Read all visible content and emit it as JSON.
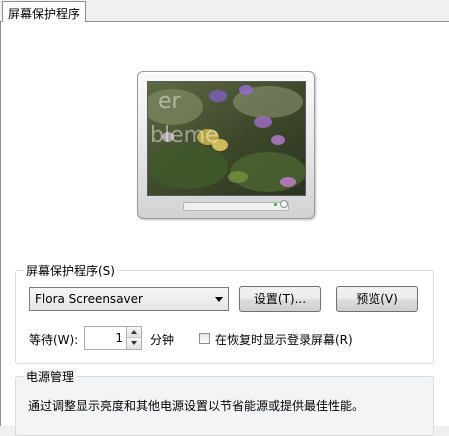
{
  "tab": {
    "label": "屏幕保护程序"
  },
  "screensaver_group": {
    "title": "屏幕保护程序(S)",
    "selected": "Flora Screensaver",
    "settings_button": "设置(T)...",
    "preview_button": "预览(V)",
    "wait_label": "等待(W):",
    "wait_value": "1",
    "minutes_label": "分钟",
    "logon_checkbox_label": "在恢复时显示登录屏幕(R)",
    "logon_checkbox_checked": false
  },
  "power_group": {
    "title": "电源管理",
    "description": "通过调整显示亮度和其他电源设置以节省能源或提供最佳性能。"
  },
  "icons": {
    "dropdown": "chevron-down-icon",
    "spin_up": "spin-up-icon",
    "spin_down": "spin-down-icon",
    "monitor": "monitor-preview-icon",
    "power_led": "power-led-icon"
  },
  "colors": {
    "window_bg": "#f0f0f0",
    "page_bg": "#ffffff",
    "power_group_bg": "#f3f4f5",
    "led_green": "#24b82c"
  }
}
